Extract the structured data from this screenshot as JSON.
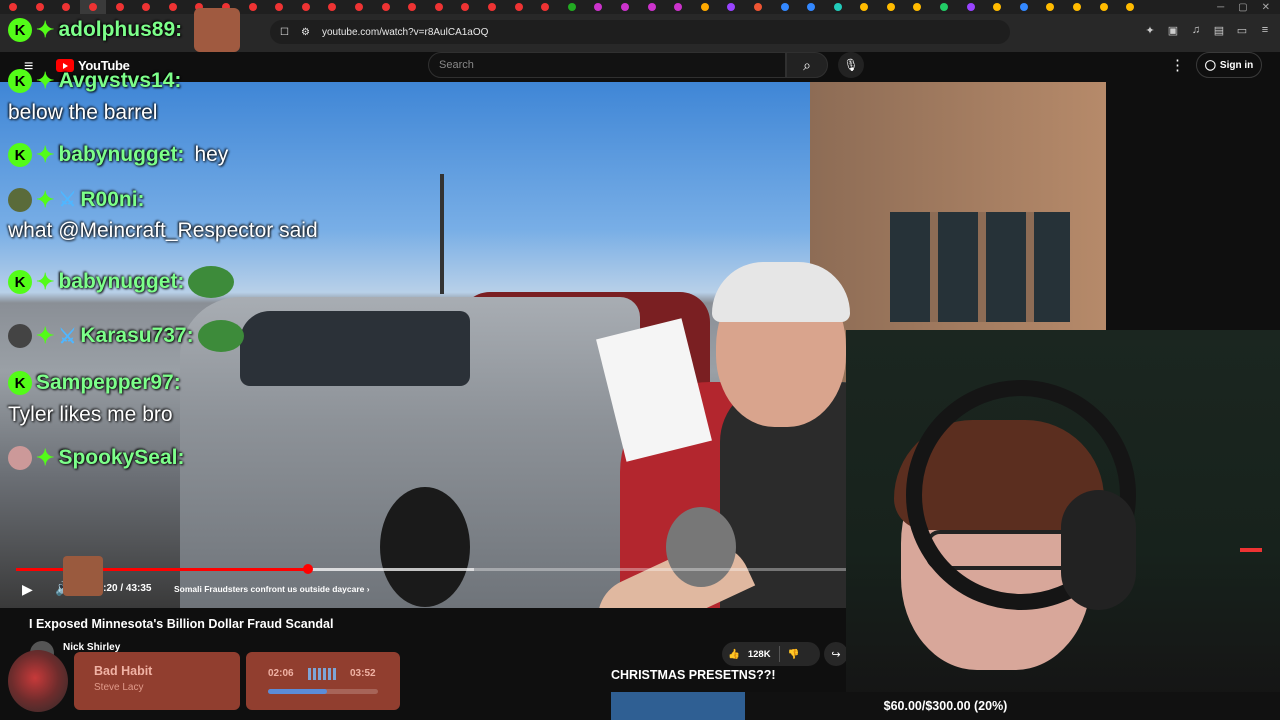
{
  "browser": {
    "url": "youtube.com/watch?v=r8AulCA1aOQ"
  },
  "youtube": {
    "logo_text": "YouTube",
    "search_placeholder": "Search",
    "sign_in_label": "Sign in"
  },
  "video": {
    "current_time": "15:20",
    "duration": "43:35",
    "time_display": "15:20 / 43:35",
    "progress_fraction": 0.352,
    "chapter": "Somali Fraudsters confront us outside daycare",
    "title": "I Exposed Minnesota's Billion Dollar Fraud Scandal",
    "channel": "Nick Shirley",
    "likes": "128K"
  },
  "chat": {
    "streamer_name": "adolphus89:",
    "messages": [
      {
        "user": "Avgvstvs14:",
        "text": "below the barrel"
      },
      {
        "user": "babynugget:",
        "text": "hey"
      },
      {
        "user": "R00ni:",
        "text": "what @Meincraft_Respector said"
      },
      {
        "user": "babynugget:",
        "text": ""
      },
      {
        "user": "Karasu737:",
        "text": ""
      },
      {
        "user": "Sampepper97:",
        "text": "Tyler likes me bro"
      },
      {
        "user": "SpookySeal:",
        "text": ""
      }
    ]
  },
  "now_playing": {
    "song": "Bad Habit",
    "artist": "Steve Lacy",
    "elapsed": "02:06",
    "total": "03:52",
    "progress_fraction": 0.54
  },
  "goal": {
    "label": "CHRISTMAS PRESETNS??!",
    "text": "$60.00/$300.00 (20%)",
    "fraction": 0.2
  },
  "colors": {
    "kick_green": "#53fc18",
    "youtube_red": "#ff0000",
    "goal_blue": "#2f5f93"
  }
}
